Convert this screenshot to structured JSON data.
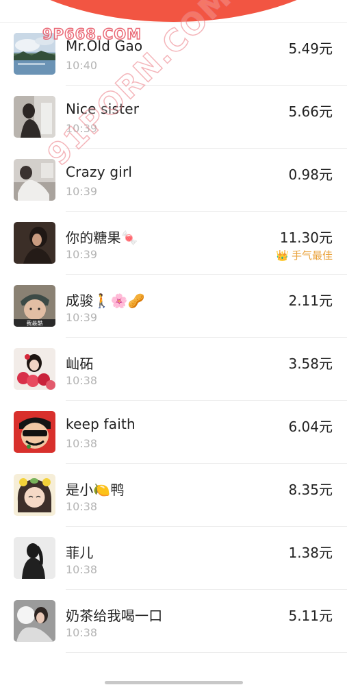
{
  "header": {
    "accent_color": "#f25542"
  },
  "list": [
    {
      "name": "Mr.Old Gao",
      "time": "10:40",
      "amount": "5.49元",
      "avatar": "landscape-avatar"
    },
    {
      "name": "Nice sister",
      "time": "10:39",
      "amount": "5.66元",
      "avatar": "person-avatar"
    },
    {
      "name": "Crazy girl",
      "time": "10:39",
      "amount": "0.98元",
      "avatar": "person-avatar"
    },
    {
      "name": "你的糖果🍬",
      "time": "10:39",
      "amount": "11.30元",
      "best_label": "手气最佳",
      "avatar": "person-avatar"
    },
    {
      "name": "成骏🚶🌸🥜",
      "time": "10:39",
      "amount": "2.11元",
      "avatar": "child-avatar",
      "avatar_caption": "我最酷"
    },
    {
      "name": "屾砳",
      "time": "10:38",
      "amount": "3.58元",
      "avatar": "flowers-avatar"
    },
    {
      "name": "keep faith",
      "time": "10:38",
      "amount": "6.04元",
      "avatar": "cartoon-avatar"
    },
    {
      "name": "是小🍋鸭",
      "time": "10:38",
      "amount": "8.35元",
      "avatar": "cartoon-girl-avatar"
    },
    {
      "name": "菲儿",
      "time": "10:38",
      "amount": "1.38元",
      "avatar": "silhouette-avatar"
    },
    {
      "name": "奶茶给我喝一口",
      "time": "10:38",
      "amount": "5.11元",
      "avatar": "person-avatar"
    }
  ],
  "watermarks": {
    "top": "9P668.COM",
    "diagonal": "91PORN.COM"
  }
}
